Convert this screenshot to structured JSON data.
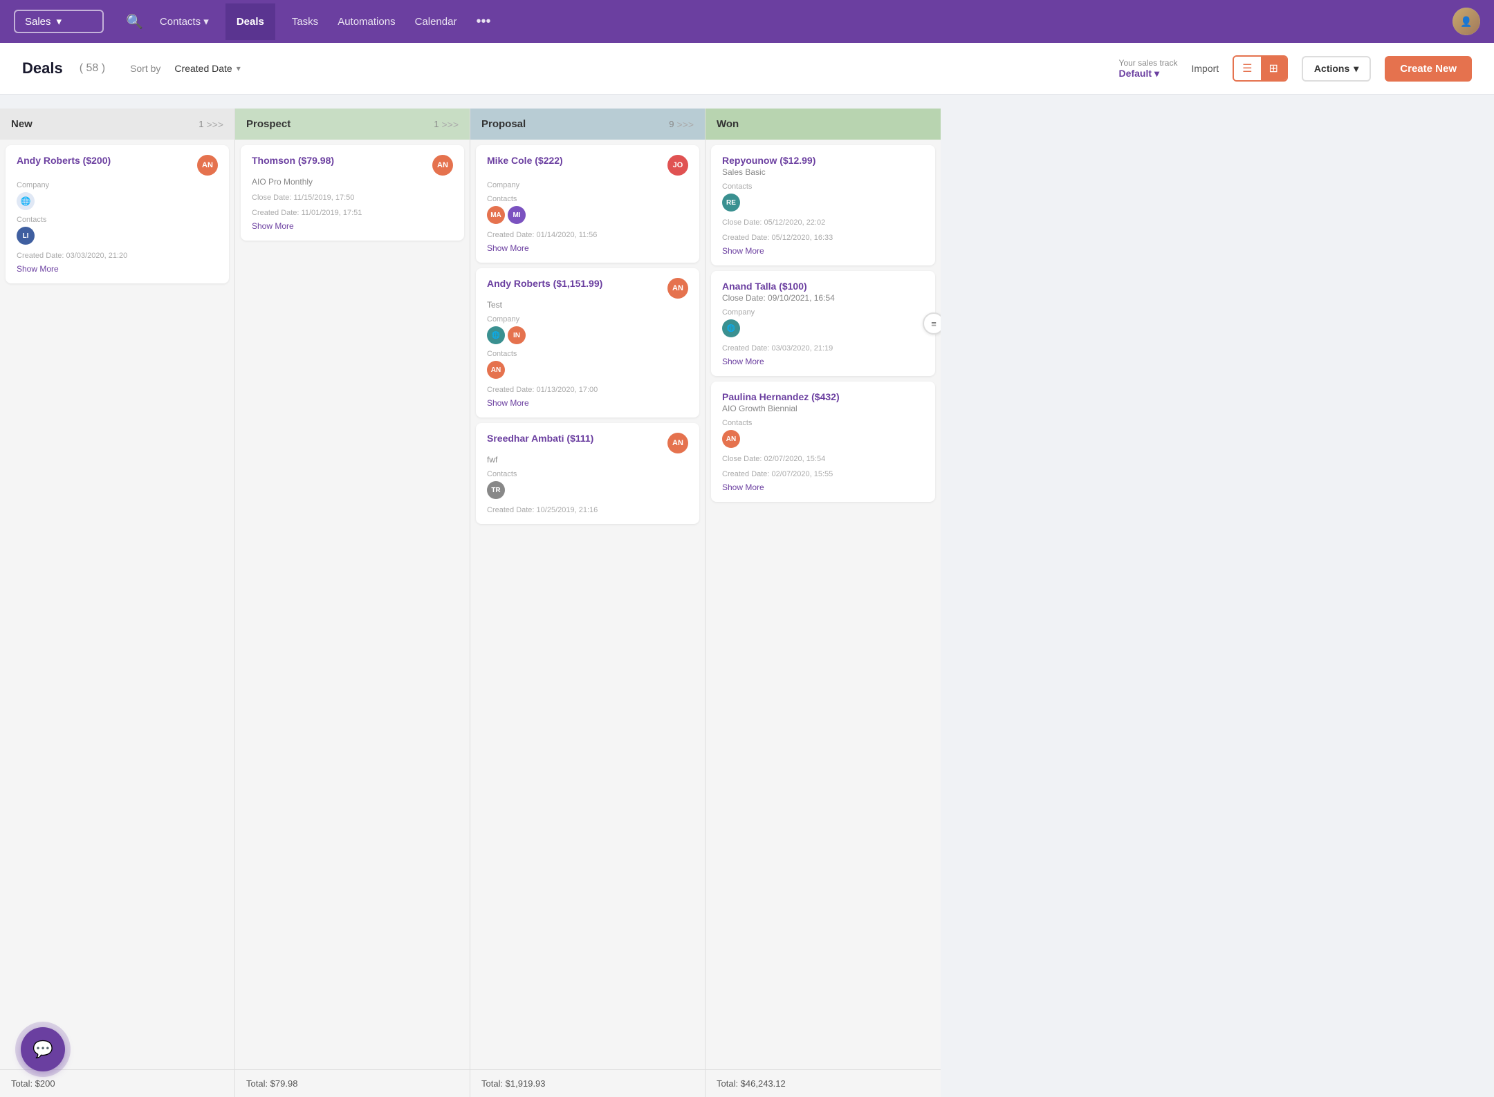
{
  "nav": {
    "sales_selector": "Sales",
    "search_icon": "🔍",
    "links": [
      {
        "label": "Contacts",
        "has_arrow": true,
        "active": false
      },
      {
        "label": "Deals",
        "has_arrow": false,
        "active": true
      },
      {
        "label": "Tasks",
        "has_arrow": false,
        "active": false
      },
      {
        "label": "Automations",
        "has_arrow": false,
        "active": false
      },
      {
        "label": "Calendar",
        "has_arrow": false,
        "active": false
      }
    ],
    "more_icon": "•••"
  },
  "header": {
    "title": "Deals",
    "count": "( 58 )",
    "sort_label": "Sort by",
    "sort_value": "Created Date",
    "sales_track_label": "Your sales track",
    "sales_track_value": "Default",
    "import_label": "Import",
    "actions_label": "Actions",
    "create_new_label": "Create New"
  },
  "columns": [
    {
      "id": "new",
      "title": "New",
      "count": "1",
      "header_class": "new-header",
      "total": "Total: $200",
      "cards": [
        {
          "id": "andy-roberts-new",
          "title": "Andy Roberts ($200)",
          "badge": "AN",
          "badge_class": "badge-orange",
          "subtitle": "Company",
          "has_company_icon": true,
          "contacts_label": "Contacts",
          "contacts": [
            {
              "initials": "LI",
              "class": "ca-blue"
            }
          ],
          "date": "Created Date: 03/03/2020, 21:20",
          "show_more": "Show More",
          "has_filter_icon": false
        }
      ]
    },
    {
      "id": "prospect",
      "title": "Prospect",
      "count": "1",
      "header_class": "prospect-header",
      "total": "Total: $79.98",
      "cards": [
        {
          "id": "thomson-prospect",
          "title": "Thomson ($79.98)",
          "badge": "AN",
          "badge_class": "badge-orange",
          "subtitle": "AIO Pro Monthly",
          "has_company_icon": false,
          "close_date": "Close Date: 11/15/2019, 17:50",
          "created_date_label": "Created Date: 11/01/2019, 17:51",
          "contacts_label": "",
          "contacts": [],
          "date": "",
          "show_more": "Show More",
          "has_filter_icon": false
        }
      ]
    },
    {
      "id": "proposal",
      "title": "Proposal",
      "count": "9",
      "header_class": "proposal-header",
      "total": "Total: $1,919.93",
      "cards": [
        {
          "id": "mike-cole-proposal",
          "title": "Mike Cole ($222)",
          "badge": "JO",
          "badge_class": "badge-red",
          "subtitle": "Company",
          "has_company_icon": false,
          "contacts_label": "Contacts",
          "contacts": [
            {
              "initials": "MA",
              "class": "ca-orange"
            },
            {
              "initials": "MI",
              "class": "ca-purple"
            }
          ],
          "date": "Created Date: 01/14/2020, 11:56",
          "show_more": "Show More",
          "has_filter_icon": false
        },
        {
          "id": "andy-roberts-proposal",
          "title": "Andy Roberts ($1,151.99)",
          "badge": "AN",
          "badge_class": "badge-orange",
          "subtitle": "Test",
          "company_label": "Company",
          "has_company_icon": true,
          "contacts_label": "Contacts",
          "contacts": [
            {
              "initials": "AN",
              "class": "ca-orange"
            }
          ],
          "company_contacts": [
            {
              "initials": "🌐",
              "class": "ca-teal",
              "is_globe": true
            },
            {
              "initials": "IN",
              "class": "ca-orange"
            }
          ],
          "date": "Created Date: 01/13/2020, 17:00",
          "show_more": "Show More",
          "has_filter_icon": false
        },
        {
          "id": "sreedhar-ambati-proposal",
          "title": "Sreedhar Ambati ($111)",
          "badge": "AN",
          "badge_class": "badge-orange",
          "subtitle": "fwf",
          "contacts_label": "Contacts",
          "contacts": [
            {
              "initials": "TR",
              "class": "ca-gray"
            }
          ],
          "date": "Created Date: 10/25/2019, 21:16",
          "show_more": "",
          "has_filter_icon": false
        }
      ]
    },
    {
      "id": "won",
      "title": "Won",
      "count": "",
      "header_class": "won-header",
      "total": "Total: $46,243.12",
      "cards": [
        {
          "id": "repyounow-won",
          "title": "Repyounow ($12.99)",
          "badge": "",
          "badge_class": "",
          "subtitle": "Sales Basic",
          "close_date": "Close Date: 05/12/2020, 22:02",
          "contacts_label": "Contacts",
          "contacts": [
            {
              "initials": "RE",
              "class": "ca-teal"
            }
          ],
          "date": "Created Date: 05/12/2020, 16:33",
          "show_more": "Show More",
          "has_filter_icon": false
        },
        {
          "id": "anand-talla-won",
          "title": "Anand Talla ($100)",
          "badge": "",
          "badge_class": "",
          "subtitle": "Close Date: 09/10/2021, 16:54",
          "company_label": "Company",
          "has_company_icon": true,
          "contacts_label": "",
          "contacts": [],
          "date": "Created Date: 03/03/2020, 21:19",
          "show_more": "Show More",
          "has_filter_icon": true
        },
        {
          "id": "paulina-hernandez-won",
          "title": "Paulina Hernandez ($432)",
          "badge": "",
          "badge_class": "",
          "subtitle": "AIO Growth Biennial",
          "close_date": "Close Date: 02/07/2020, 15:54",
          "contacts_label": "Contacts",
          "contacts": [
            {
              "initials": "AN",
              "class": "ca-orange"
            }
          ],
          "date": "Created Date: 02/07/2020, 15:55",
          "show_more": "Show More",
          "has_filter_icon": false
        }
      ]
    }
  ]
}
